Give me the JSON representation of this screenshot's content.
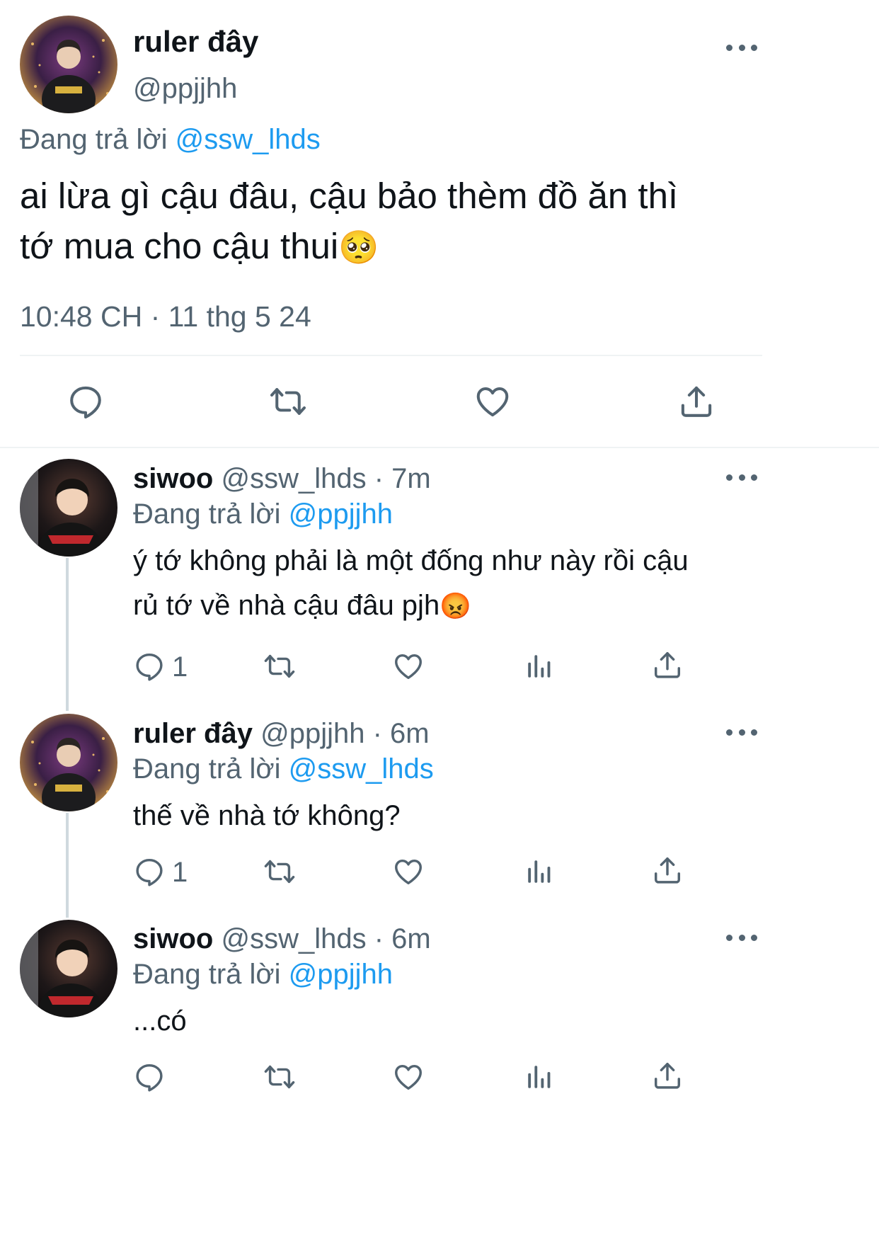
{
  "main_tweet": {
    "display_name": "ruler đây",
    "handle": "@ppjjhh",
    "replying_prefix": "Đang trả lời",
    "replying_to": "@ssw_lhds",
    "text_line1": "ai lừa gì cậu đâu, cậu bảo thèm đồ ăn thì",
    "text_line2": "tớ mua cho cậu thui",
    "emoji": "🥺",
    "timestamp": "10:48 CH · 11 thg 5 24",
    "actions": [
      "reply-icon",
      "retweet-icon",
      "like-icon",
      "share-icon"
    ]
  },
  "replies": [
    {
      "display_name": "siwoo",
      "handle": "@ssw_lhds",
      "time": "· 7m",
      "replying_prefix": "Đang trả lời",
      "replying_to": "@ppjjhh",
      "text_line1": "ý tớ không phải là một đống như này rồi cậu",
      "text_line2": "rủ tớ về nhà cậu đâu pjh",
      "emoji": "😡",
      "reply_count": "1"
    },
    {
      "display_name": "ruler đây",
      "handle": "@ppjjhh",
      "time": "· 6m",
      "replying_prefix": "Đang trả lời",
      "replying_to": "@ssw_lhds",
      "text_line1": "thế về nhà tớ không?",
      "reply_count": "1"
    },
    {
      "display_name": "siwoo",
      "handle": "@ssw_lhds",
      "time": "· 6m",
      "replying_prefix": "Đang trả lời",
      "replying_to": "@ppjjhh",
      "text_line1": "...có",
      "reply_count": ""
    }
  ],
  "colors": {
    "link": "#1d9bf0",
    "secondary": "#536471",
    "divider": "#eff3f4"
  }
}
